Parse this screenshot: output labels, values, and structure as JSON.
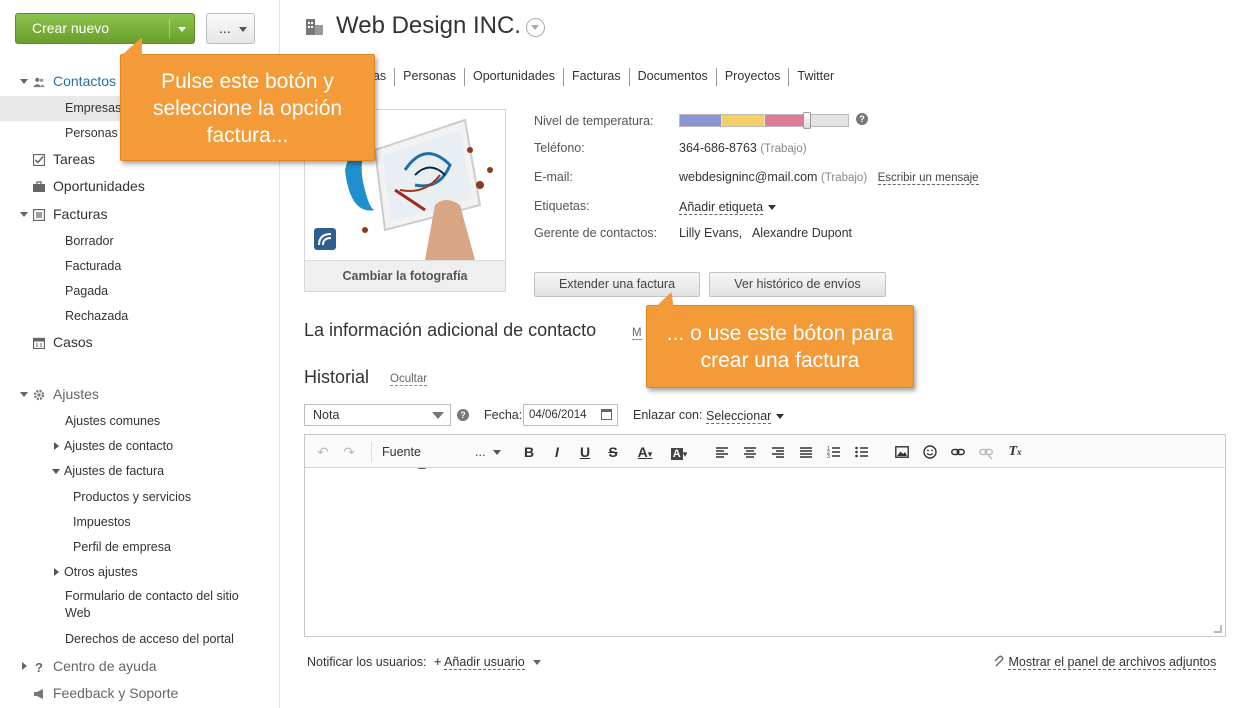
{
  "toolbar": {
    "create_label": "Crear nuevo",
    "more_label": "..."
  },
  "sidebar": {
    "contacts": "Contactos",
    "empresas": "Empresas",
    "personas": "Personas",
    "tareas": "Tareas",
    "oportunidades": "Oportunidades",
    "facturas": "Facturas",
    "borrador": "Borrador",
    "facturada": "Facturada",
    "pagada": "Pagada",
    "rechazada": "Rechazada",
    "casos": "Casos",
    "ajustes": "Ajustes",
    "ajustes_comunes": "Ajustes comunes",
    "ajustes_contacto": "Ajustes de contacto",
    "ajustes_factura": "Ajustes de factura",
    "productos": "Productos y servicios",
    "impuestos": "Impuestos",
    "perfil": "Perfil de empresa",
    "otros": "Otros ajustes",
    "formulario": "Formulario de contacto del sitio Web",
    "derechos": "Derechos de acceso del portal",
    "ayuda": "Centro de ayuda",
    "feedback": "Feedback y Soporte"
  },
  "header": {
    "title": "Web Design INC."
  },
  "tabs": [
    "eas",
    "Personas",
    "Oportunidades",
    "Facturas",
    "Documentos",
    "Proyectos",
    "Twitter"
  ],
  "photo": {
    "caption": "Cambiar la fotografía"
  },
  "details": {
    "temp_label": "Nivel de temperatura:",
    "phone_label": "Teléfono:",
    "phone_value": "364-686-8763",
    "phone_type": "(Trabajo)",
    "email_label": "E-mail:",
    "email_value": "webdesigninc@mail.com",
    "email_type": "(Trabajo)",
    "email_action": "Escribir un mensaje",
    "tags_label": "Etiquetas:",
    "tags_action": "Añadir etiqueta",
    "manager_label": "Gerente de contactos:",
    "manager_value": "Lilly Evans,   Alexandre Dupont",
    "temp_colors": [
      "#8b95d4",
      "#f5cf68",
      "#e07a95"
    ]
  },
  "actions": {
    "invoice": "Extender una factura",
    "history": "Ver histórico de envíos"
  },
  "sections": {
    "extra_info": "La información adicional de contacto",
    "extra_info_link": "M",
    "history": "Historial",
    "history_link": "Ocultar"
  },
  "history_form": {
    "type_value": "Nota",
    "date_label": "Fecha:",
    "date_value": "04/06/2014",
    "link_label": "Enlazar con:",
    "link_value": "Seleccionar",
    "font_label": "Fuente",
    "size_label": "..."
  },
  "footer": {
    "notify_label": "Notificar los usuarios:",
    "add_user": "Añadir usuario",
    "attachments": "Mostrar el panel de archivos adjuntos"
  },
  "callouts": {
    "first": "Pulse este botón y seleccione la opción factura...",
    "second": "... o use este bóton para crear una factura"
  }
}
